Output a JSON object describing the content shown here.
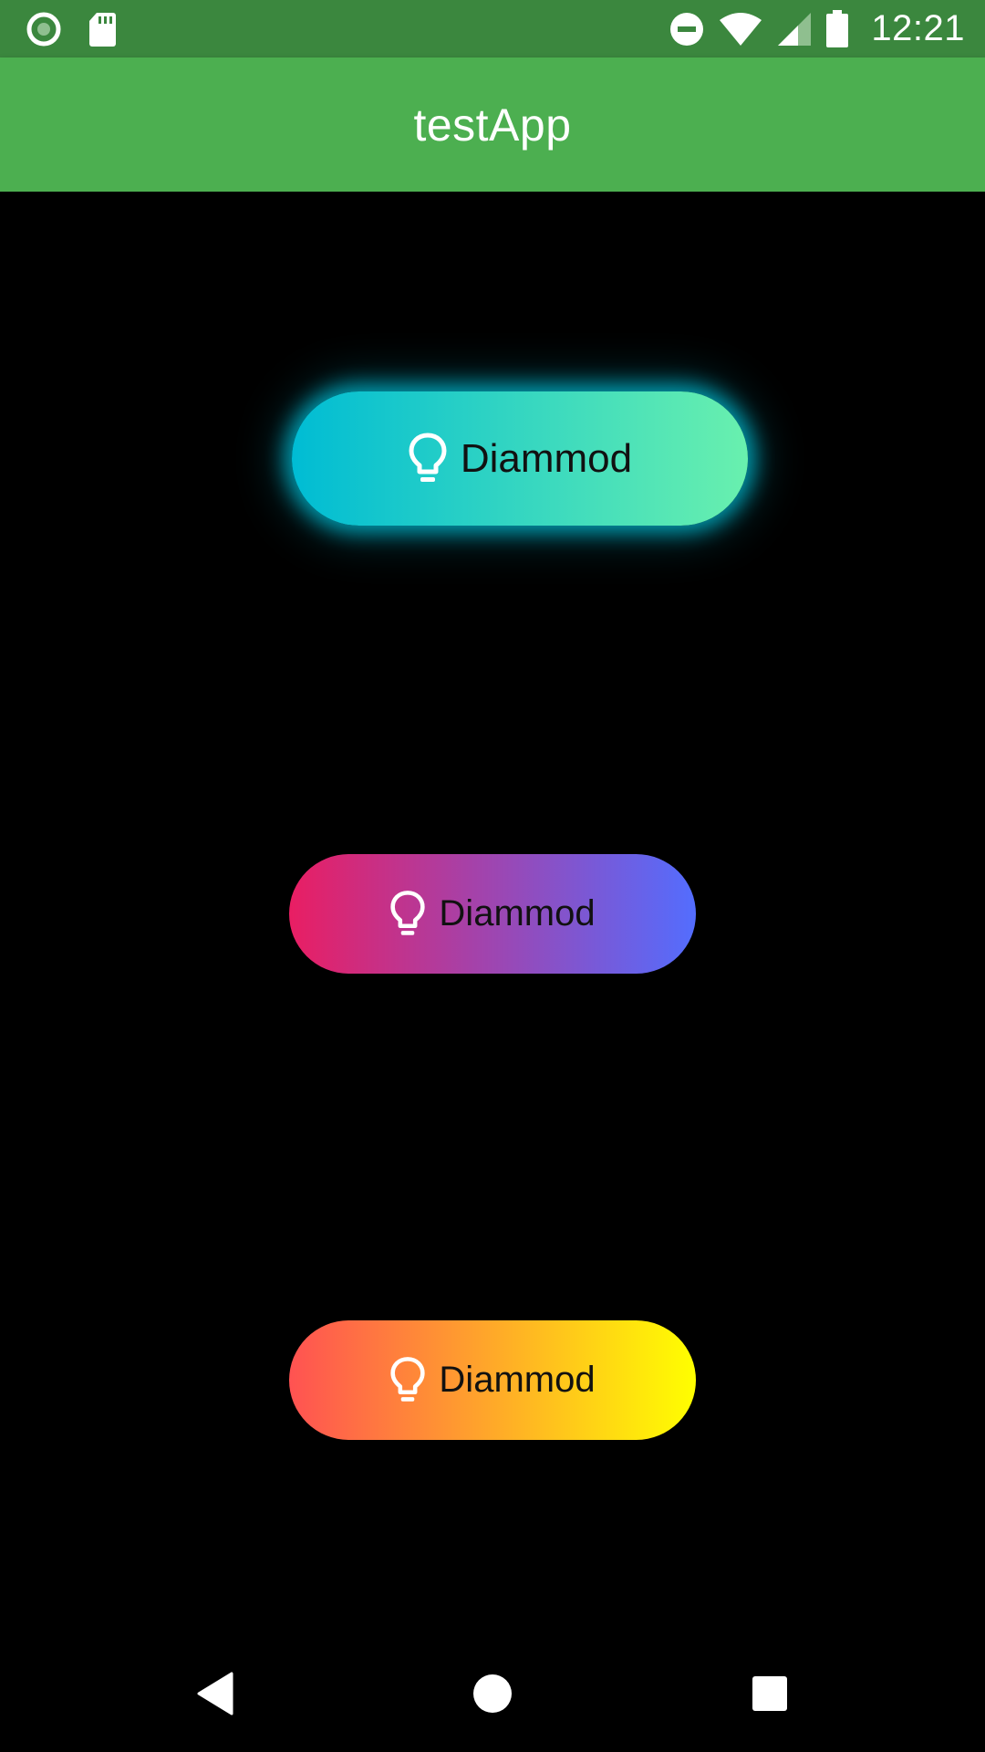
{
  "status_bar": {
    "time": "12:21",
    "left_icons": [
      "record-icon",
      "sd-card-icon"
    ],
    "right_icons": [
      "do-not-disturb-icon",
      "wifi-icon",
      "cell-signal-icon",
      "battery-icon"
    ],
    "color": "#3b873e"
  },
  "app_bar": {
    "title": "testApp",
    "color": "#4caf50"
  },
  "buttons": [
    {
      "label": "Diammod",
      "icon": "lightbulb-icon",
      "gradient": [
        "#00bcd4",
        "#69f0ae"
      ],
      "glow": "#00bcd4"
    },
    {
      "label": "Diammod",
      "icon": "lightbulb-icon",
      "gradient": [
        "#e91e63",
        "#536dfe"
      ]
    },
    {
      "label": "Diammod",
      "icon": "lightbulb-icon",
      "gradient": [
        "#ff5252",
        "#ffff00"
      ]
    }
  ],
  "nav_bar": {
    "items": [
      "back-icon",
      "home-icon",
      "recents-icon"
    ]
  }
}
